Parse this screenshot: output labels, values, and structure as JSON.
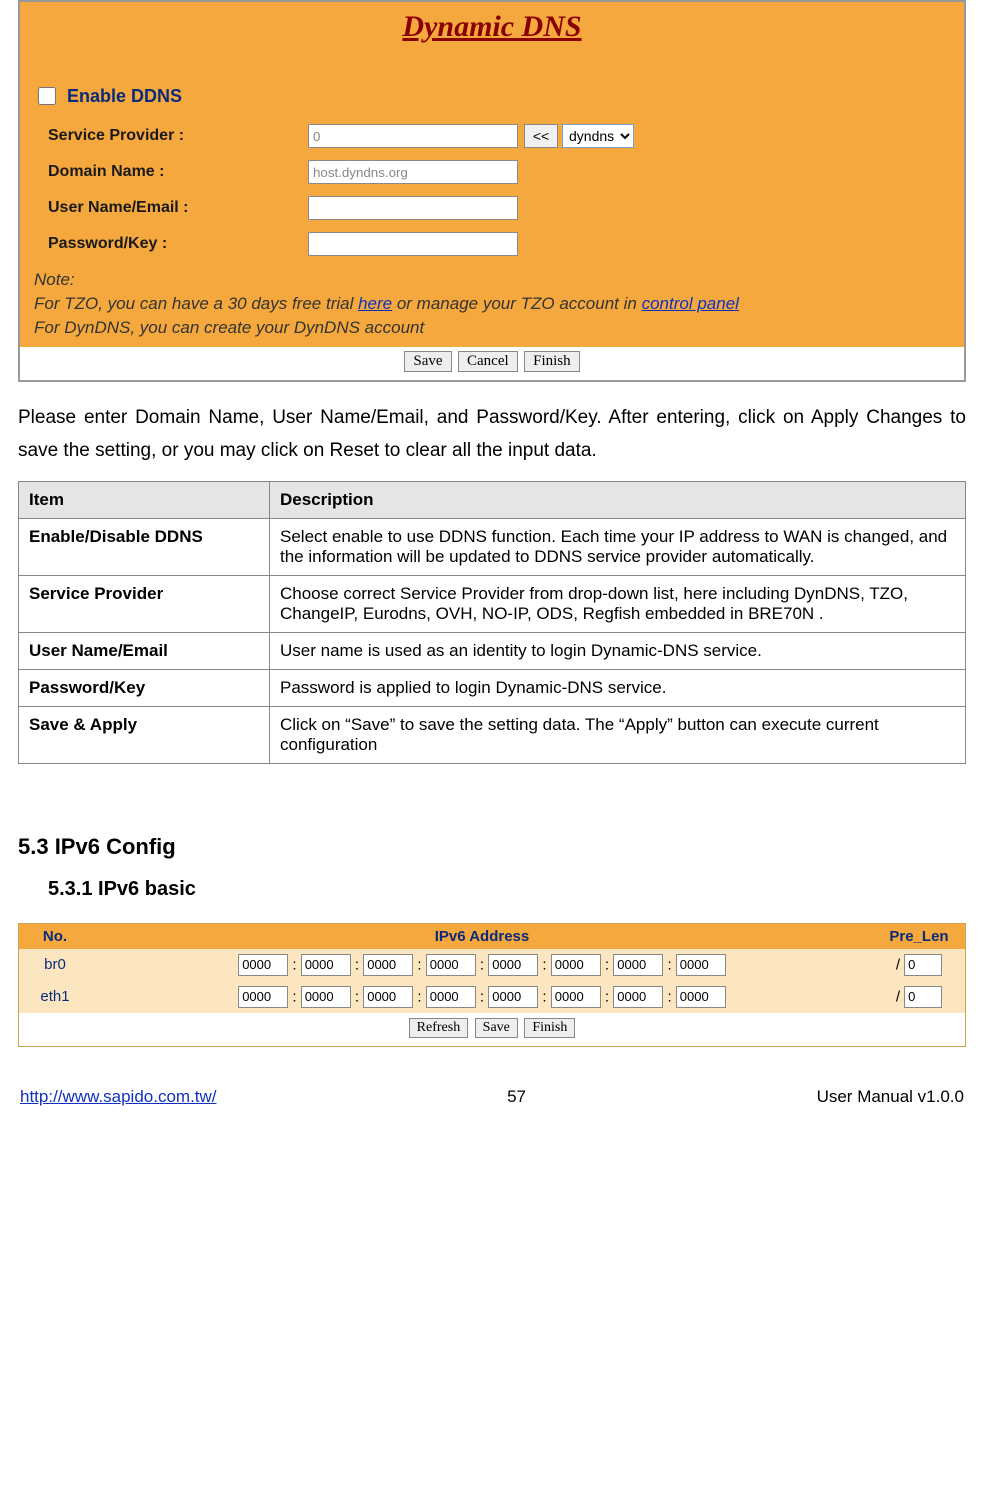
{
  "ddns": {
    "title": "Dynamic DNS",
    "enable_label": "Enable DDNS",
    "service_label": "Service Provider :",
    "service_value": "0",
    "back_btn": "<<",
    "service_select": "dyndns",
    "domain_label": "Domain Name :",
    "domain_value": "host.dyndns.org",
    "user_label": "User Name/Email :",
    "user_value": "",
    "pass_label": "Password/Key :",
    "pass_value": "",
    "note_label": "Note:",
    "note_l1a": "For TZO, you can have a 30 days free trial ",
    "note_here": "here",
    "note_l1b": " or manage your TZO account in ",
    "note_cp": "control panel",
    "note_l2": "For DynDNS, you can create your DynDNS account",
    "btn_save": "Save",
    "btn_cancel": "Cancel",
    "btn_finish": "Finish"
  },
  "prose1": "Please enter Domain Name, User Name/Email, and Password/Key. After entering, click on Apply Changes to save the setting, or you may click on Reset to clear all the input data.",
  "table": {
    "h_item": "Item",
    "h_desc": "Description",
    "rows": [
      {
        "item": "Enable/Disable DDNS",
        "desc": "Select enable to use DDNS function. Each time your IP address to WAN is changed, and the information will be updated to DDNS service provider automatically."
      },
      {
        "item": "Service Provider",
        "desc": "Choose correct Service Provider from drop-down list, here including DynDNS, TZO, ChangeIP, Eurodns, OVH, NO-IP, ODS, Regfish embedded in BRE70N ."
      },
      {
        "item": "User Name/Email",
        "desc": "User name is used as an identity to login Dynamic-DNS service."
      },
      {
        "item": "Password/Key",
        "desc": "Password is applied to login Dynamic-DNS service."
      },
      {
        "item": "Save & Apply",
        "desc": "Click on “Save” to save the setting data. The “Apply” button can execute current configuration"
      }
    ]
  },
  "sec53": "5.3    IPv6 Config",
  "sec531": "5.3.1    IPv6 basic",
  "ipv6": {
    "h_no": "No.",
    "h_addr": "IPv6 Address",
    "h_len": "Pre_Len",
    "rows": [
      {
        "iface": "br0",
        "segs": [
          "0000",
          "0000",
          "0000",
          "0000",
          "0000",
          "0000",
          "0000",
          "0000"
        ],
        "len": "0"
      },
      {
        "iface": "eth1",
        "segs": [
          "0000",
          "0000",
          "0000",
          "0000",
          "0000",
          "0000",
          "0000",
          "0000"
        ],
        "len": "0"
      }
    ],
    "btn_refresh": "Refresh",
    "btn_save": "Save",
    "btn_finish": "Finish"
  },
  "footer": {
    "url": "http://www.sapido.com.tw/",
    "page": "57",
    "right": "User  Manual  v1.0.0"
  }
}
